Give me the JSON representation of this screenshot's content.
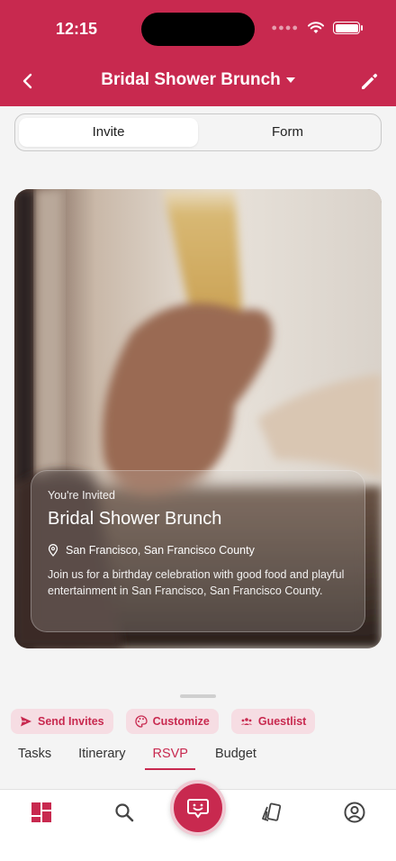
{
  "status_bar": {
    "time": "12:15"
  },
  "nav": {
    "title": "Bridal Shower Brunch"
  },
  "segments": [
    {
      "label": "Invite",
      "active": true
    },
    {
      "label": "Form",
      "active": false
    }
  ],
  "invite": {
    "eyebrow": "You're Invited",
    "title": "Bridal Shower Brunch",
    "location": "San Francisco, San Francisco County",
    "description": "Join us for a birthday celebration with good food and playful entertainment in San Francisco, San Francisco County."
  },
  "actions": [
    {
      "label": "Send Invites",
      "icon": "send-icon"
    },
    {
      "label": "Customize",
      "icon": "palette-icon"
    },
    {
      "label": "Guestlist",
      "icon": "people-icon"
    }
  ],
  "tabs": [
    {
      "label": "Tasks",
      "active": false
    },
    {
      "label": "Itinerary",
      "active": false
    },
    {
      "label": "RSVP",
      "active": true
    },
    {
      "label": "Budget",
      "active": false
    }
  ],
  "bottom_nav": [
    "dashboard-icon",
    "search-icon",
    "assistant-icon",
    "cards-icon",
    "profile-icon"
  ],
  "colors": {
    "brand": "#c8294f",
    "chip_bg": "#f6dde3"
  }
}
